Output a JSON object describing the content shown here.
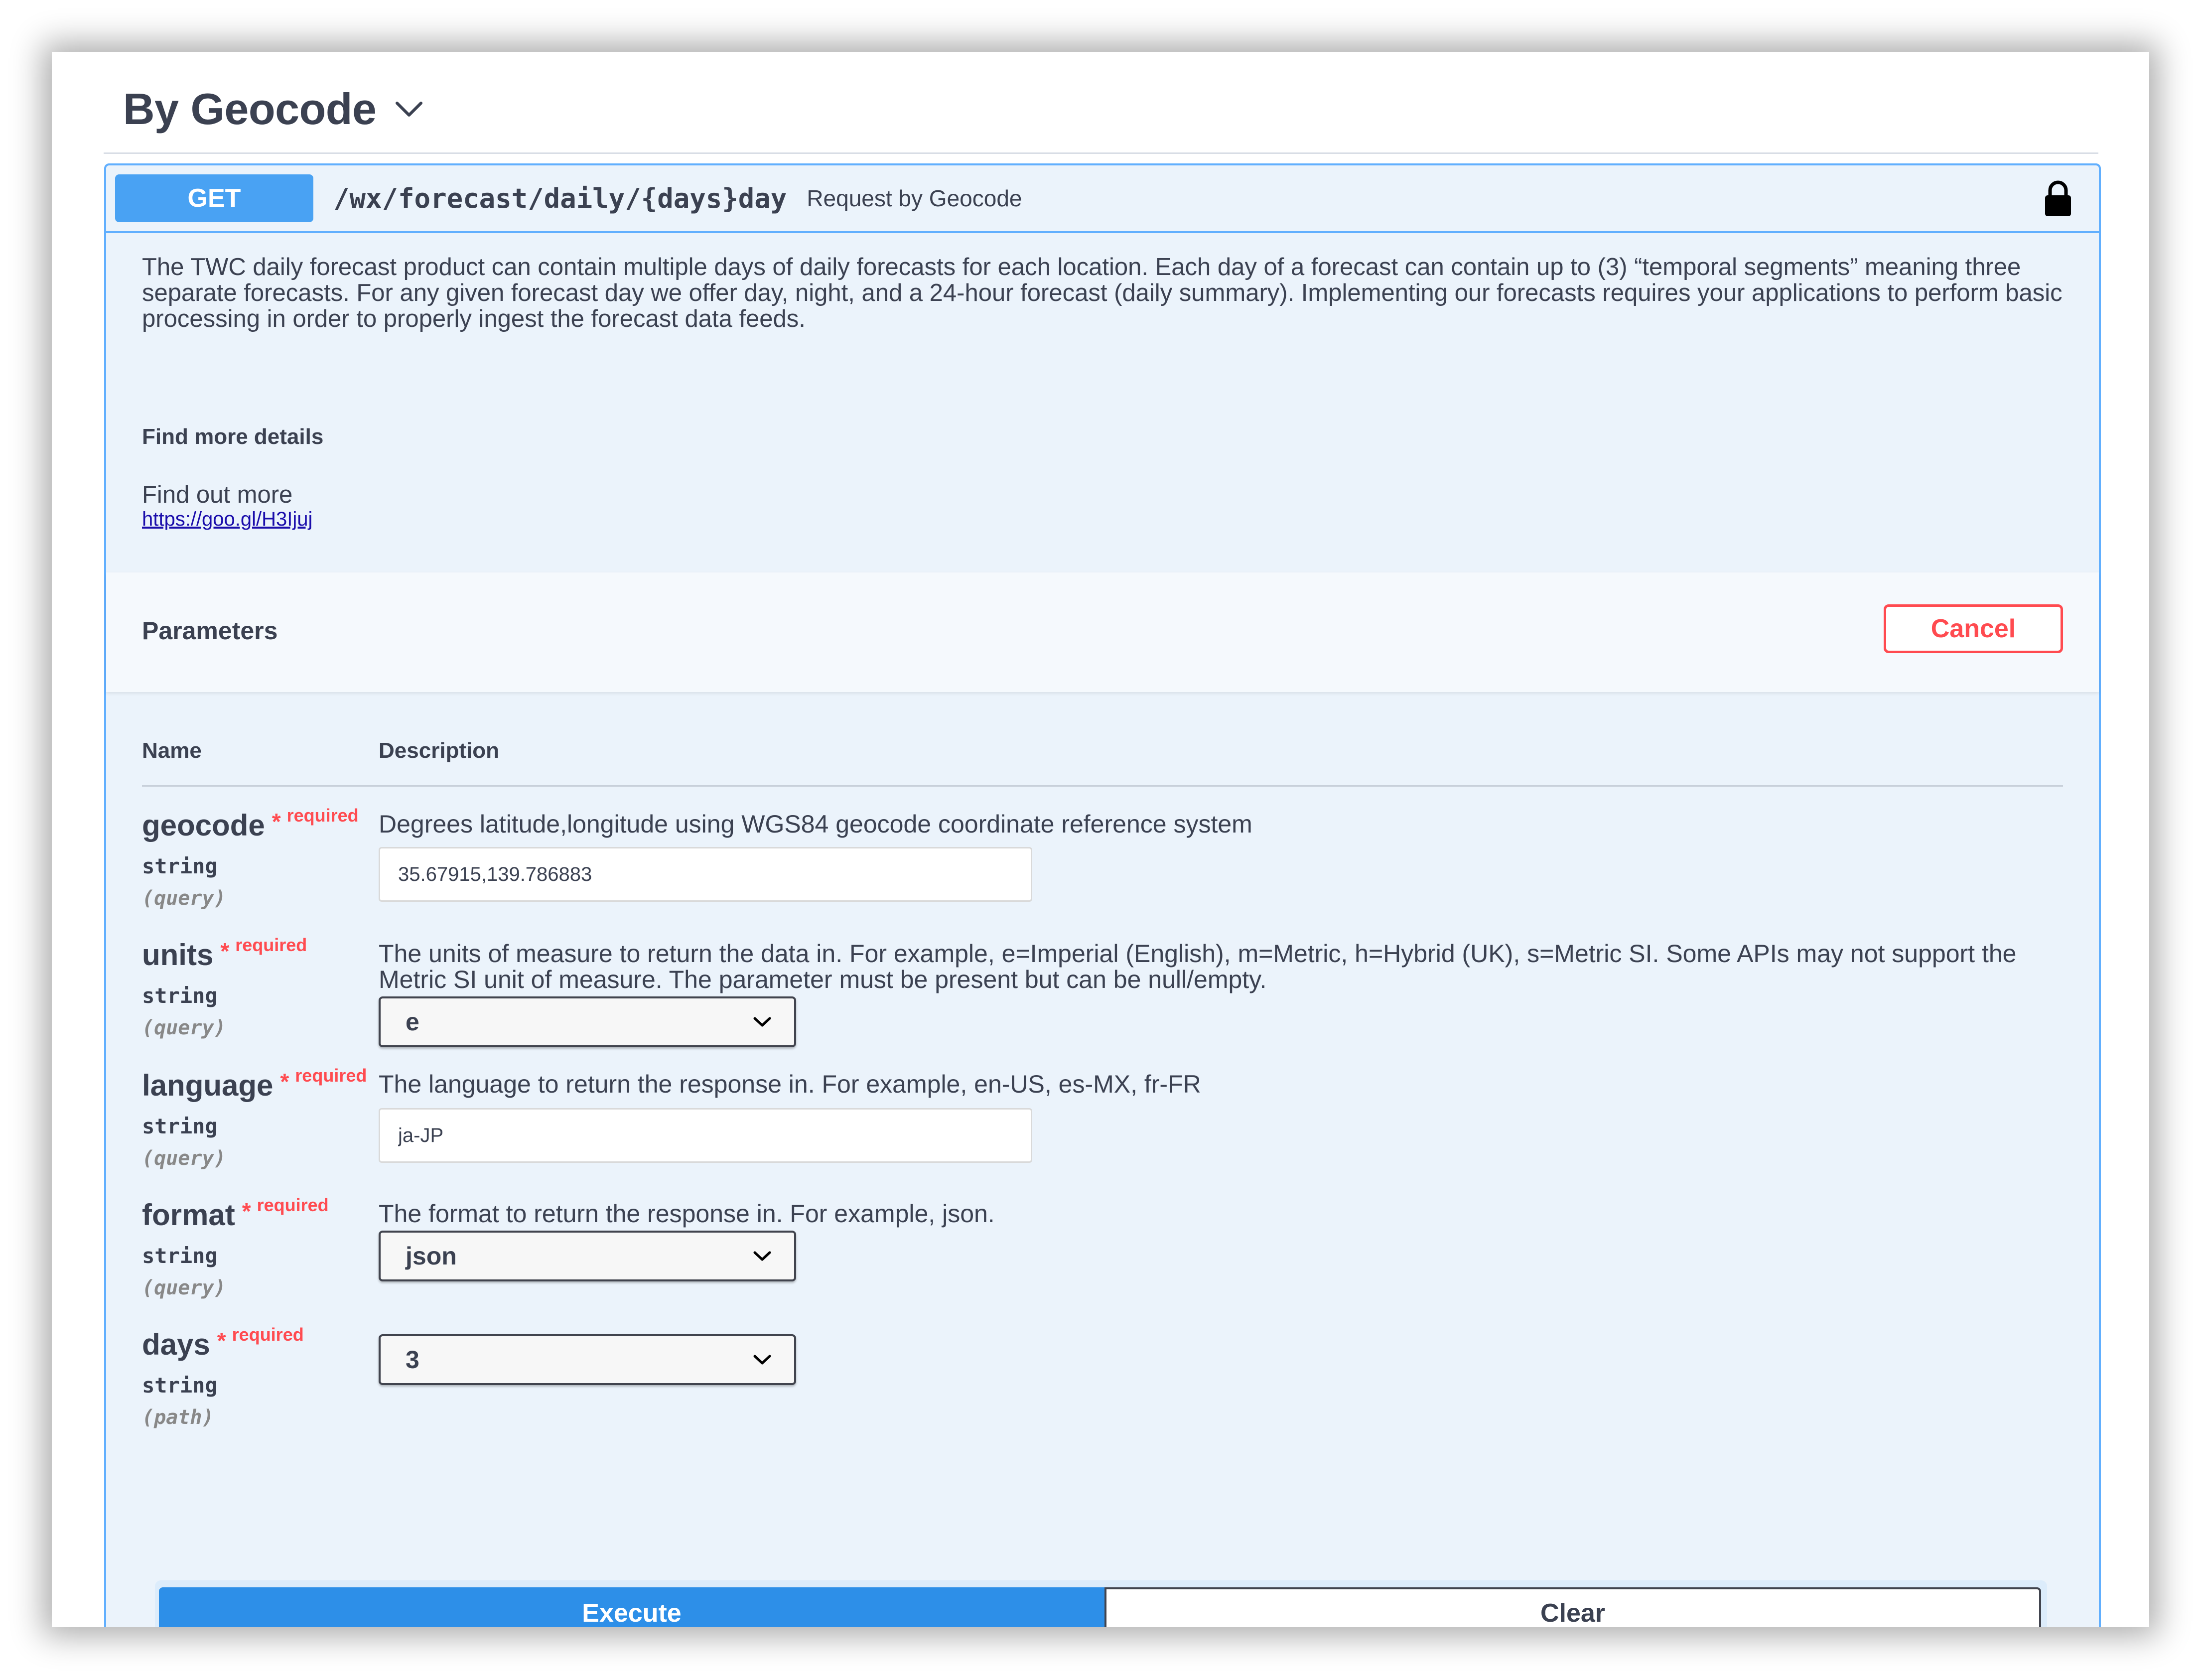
{
  "tag": {
    "title": "By Geocode"
  },
  "operation": {
    "method": "GET",
    "path": "/wx/forecast/daily/{days}day",
    "summary": "Request by Geocode",
    "description": "The TWC daily forecast product can contain multiple days of daily forecasts for each location. Each day of a forecast can contain up to (3) “temporal segments” meaning three separate forecasts. For any given forecast day we offer day, night, and a 24-hour forecast (daily summary). Implementing our forecasts requires your applications to perform basic processing in order to properly ingest the forecast data feeds.",
    "find_more_title": "Find more details",
    "find_more_text": "Find out more",
    "find_more_link": "https://goo.gl/H3Ijuj"
  },
  "parameters": {
    "title": "Parameters",
    "cancel_label": "Cancel",
    "col_name": "Name",
    "col_description": "Description",
    "items": [
      {
        "name": "geocode",
        "star": "*",
        "required_label": "required",
        "type": "string",
        "in": "(query)",
        "description": "Degrees latitude,longitude using WGS84 geocode coordinate reference system",
        "value": "35.67915,139.786883"
      },
      {
        "name": "units",
        "star": "*",
        "required_label": "required",
        "type": "string",
        "in": "(query)",
        "description": "The units of measure to return the data in. For example, e=Imperial (English), m=Metric, h=Hybrid (UK), s=Metric SI. Some APIs may not support the Metric SI unit of measure. The parameter must be present but can be null/empty.",
        "value": "e"
      },
      {
        "name": "language",
        "star": "*",
        "required_label": "required",
        "type": "string",
        "in": "(query)",
        "description": "The language to return the response in. For example, en-US, es-MX, fr-FR",
        "value": "ja-JP"
      },
      {
        "name": "format",
        "star": "*",
        "required_label": "required",
        "type": "string",
        "in": "(query)",
        "description": "The format to return the response in. For example, json.",
        "value": "json"
      },
      {
        "name": "days",
        "star": "*",
        "required_label": "required",
        "type": "string",
        "in": "(path)",
        "description": "",
        "value": "3"
      }
    ]
  },
  "actions": {
    "execute_label": "Execute",
    "clear_label": "Clear"
  },
  "icons": {
    "tag_toggle": "chevron-down-icon",
    "lock": "lock-icon",
    "select_toggle": "chevron-down-icon"
  },
  "colors": {
    "get_method": "#49a2f3",
    "op_border": "#61affe",
    "op_background": "#ebf3fb",
    "cancel": "#ff4b50",
    "required": "#ff4b50",
    "execute": "#2d8fe8",
    "link": "#1a0dab"
  }
}
